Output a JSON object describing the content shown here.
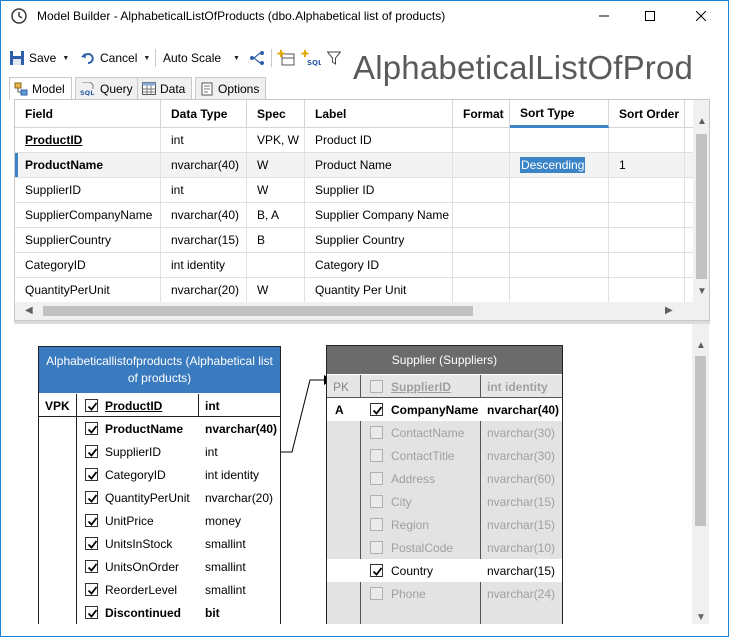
{
  "window": {
    "title": "Model Builder - AlphabeticalListOfProducts (dbo.Alphabetical list of products)",
    "big_title": "AlphabeticalListOfProd"
  },
  "toolbar": {
    "save_label": "Save",
    "cancel_label": "Cancel",
    "auto_scale_label": "Auto Scale"
  },
  "tabs": [
    {
      "label": "Model",
      "icon": "model-icon"
    },
    {
      "label": "Query",
      "icon": "sql-icon"
    },
    {
      "label": "Data",
      "icon": "table-icon"
    },
    {
      "label": "Options",
      "icon": "options-icon"
    }
  ],
  "grid": {
    "columns": [
      "Field",
      "Data Type",
      "Spec",
      "Label",
      "Format",
      "Sort Type",
      "Sort Order"
    ],
    "rows": [
      {
        "field": "ProductID",
        "type": "int",
        "spec": "VPK, W",
        "label": "Product ID",
        "format": "",
        "sort_type": "",
        "sort_order": ""
      },
      {
        "field": "ProductName",
        "type": "nvarchar(40)",
        "spec": "W",
        "label": "Product Name",
        "format": "",
        "sort_type": "Descending",
        "sort_order": "1"
      },
      {
        "field": "SupplierID",
        "type": "int",
        "spec": "W",
        "label": "Supplier ID",
        "format": "",
        "sort_type": "",
        "sort_order": ""
      },
      {
        "field": "SupplierCompanyName",
        "type": "nvarchar(40)",
        "spec": "B, A",
        "label": "Supplier Company Name",
        "format": "",
        "sort_type": "",
        "sort_order": ""
      },
      {
        "field": "SupplierCountry",
        "type": "nvarchar(15)",
        "spec": "B",
        "label": "Supplier Country",
        "format": "",
        "sort_type": "",
        "sort_order": ""
      },
      {
        "field": "CategoryID",
        "type": "int identity",
        "spec": "",
        "label": "Category ID",
        "format": "",
        "sort_type": "",
        "sort_order": ""
      },
      {
        "field": "QuantityPerUnit",
        "type": "nvarchar(20)",
        "spec": "W",
        "label": "Quantity Per Unit",
        "format": "",
        "sort_type": "",
        "sort_order": ""
      }
    ]
  },
  "entity_main": {
    "title": "Alphabeticallistofproducts (Alphabetical list of products)",
    "col_header": "VPK",
    "fields": [
      {
        "name": "ProductID",
        "type": "int",
        "checked": true
      },
      {
        "name": "ProductName",
        "type": "nvarchar(40)",
        "checked": true
      },
      {
        "name": "SupplierID",
        "type": "int",
        "checked": true
      },
      {
        "name": "CategoryID",
        "type": "int identity",
        "checked": true
      },
      {
        "name": "QuantityPerUnit",
        "type": "nvarchar(20)",
        "checked": true
      },
      {
        "name": "UnitPrice",
        "type": "money",
        "checked": true
      },
      {
        "name": "UnitsInStock",
        "type": "smallint",
        "checked": true
      },
      {
        "name": "UnitsOnOrder",
        "type": "smallint",
        "checked": true
      },
      {
        "name": "ReorderLevel",
        "type": "smallint",
        "checked": true
      },
      {
        "name": "Discontinued",
        "type": "bit",
        "checked": true
      }
    ]
  },
  "entity_supplier": {
    "title": "Supplier (Suppliers)",
    "col_header": "PK",
    "fields": [
      {
        "prefix": "",
        "name": "SupplierID",
        "type": "int identity",
        "checked": false
      },
      {
        "prefix": "A",
        "name": "CompanyName",
        "type": "nvarchar(40)",
        "checked": true
      },
      {
        "prefix": "",
        "name": "ContactName",
        "type": "nvarchar(30)",
        "checked": false
      },
      {
        "prefix": "",
        "name": "ContactTitle",
        "type": "nvarchar(30)",
        "checked": false
      },
      {
        "prefix": "",
        "name": "Address",
        "type": "nvarchar(60)",
        "checked": false
      },
      {
        "prefix": "",
        "name": "City",
        "type": "nvarchar(15)",
        "checked": false
      },
      {
        "prefix": "",
        "name": "Region",
        "type": "nvarchar(15)",
        "checked": false
      },
      {
        "prefix": "",
        "name": "PostalCode",
        "type": "nvarchar(10)",
        "checked": false
      },
      {
        "prefix": "",
        "name": "Country",
        "type": "nvarchar(15)",
        "checked": true
      },
      {
        "prefix": "",
        "name": "Phone",
        "type": "nvarchar(24)",
        "checked": false
      }
    ]
  },
  "colors": {
    "accent": "#3b84c6",
    "main_header": "#3a7bbf",
    "supplier_header": "#6b6b6b"
  }
}
